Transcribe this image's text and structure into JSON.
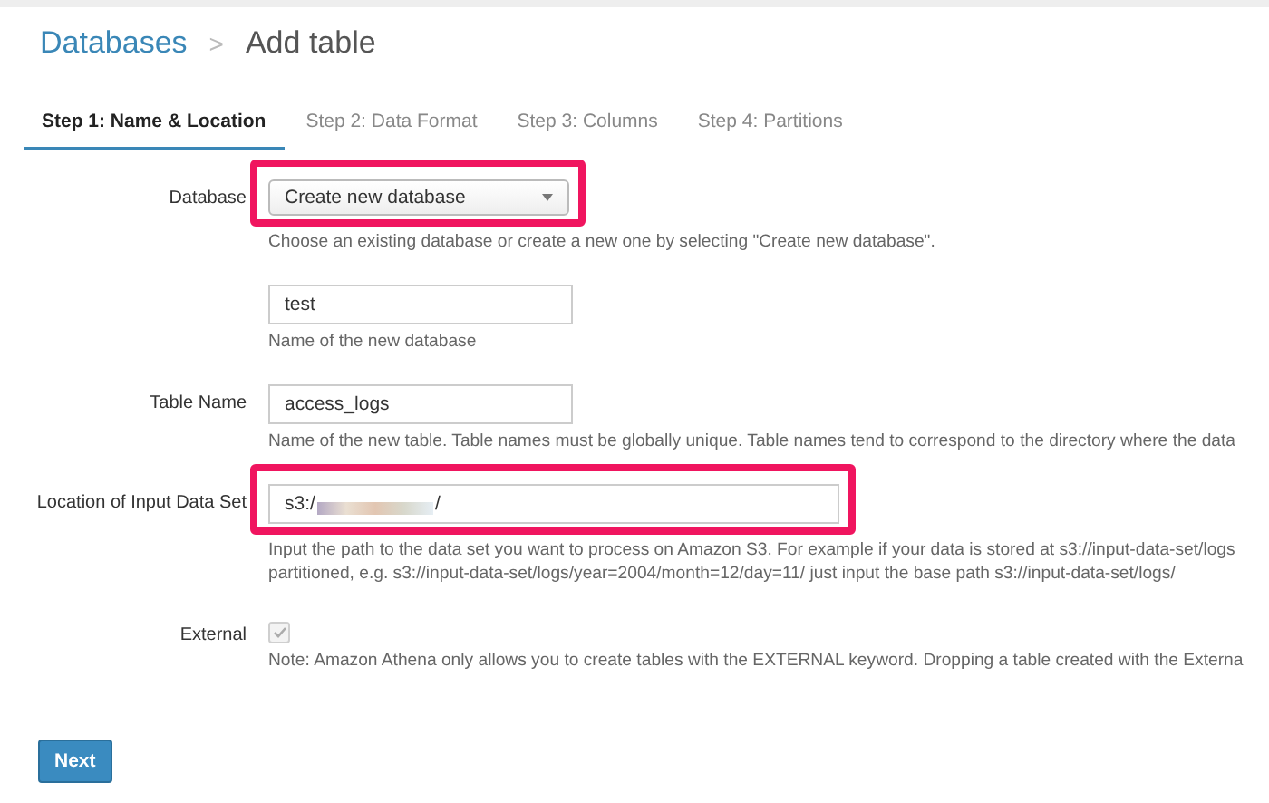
{
  "breadcrumb": {
    "parent": "Databases",
    "separator": ">",
    "current": "Add table"
  },
  "tabs": [
    {
      "label": "Step 1: Name & Location",
      "selected": true
    },
    {
      "label": "Step 2: Data Format",
      "selected": false
    },
    {
      "label": "Step 3: Columns",
      "selected": false
    },
    {
      "label": "Step 4: Partitions",
      "selected": false
    }
  ],
  "fields": [
    {
      "kind": "select",
      "label": "Database",
      "value": "Create new database",
      "highlighted": true,
      "help": [
        "Choose an existing database or create a new one by selecting \"Create new database\"."
      ]
    },
    {
      "kind": "text",
      "value": "test",
      "highlighted": false,
      "help": [
        "Name of the new database"
      ]
    },
    {
      "kind": "text",
      "label": "Table Name",
      "value": "access_logs",
      "highlighted": false,
      "help": [
        "Name of the new table. Table names must be globally unique. Table names tend to correspond to the directory where the data"
      ]
    },
    {
      "kind": "path",
      "label": "Location of Input Data Set",
      "value_start": "s3:/",
      "value_end": "/",
      "highlighted": true,
      "help": [
        "Input the path to the data set you want to process on Amazon S3. For example if your data is stored at s3://input-data-set/logs",
        "partitioned, e.g. s3://input-data-set/logs/year=2004/month=12/day=11/ just input the base path s3://input-data-set/logs/"
      ]
    },
    {
      "kind": "checkbox",
      "label": "External",
      "checked": true,
      "disabled": true,
      "highlighted": false,
      "help": [
        "Note: Amazon Athena only allows you to create tables with the EXTERNAL keyword. Dropping a table created with the Externa"
      ]
    }
  ],
  "next_button": "Next"
}
